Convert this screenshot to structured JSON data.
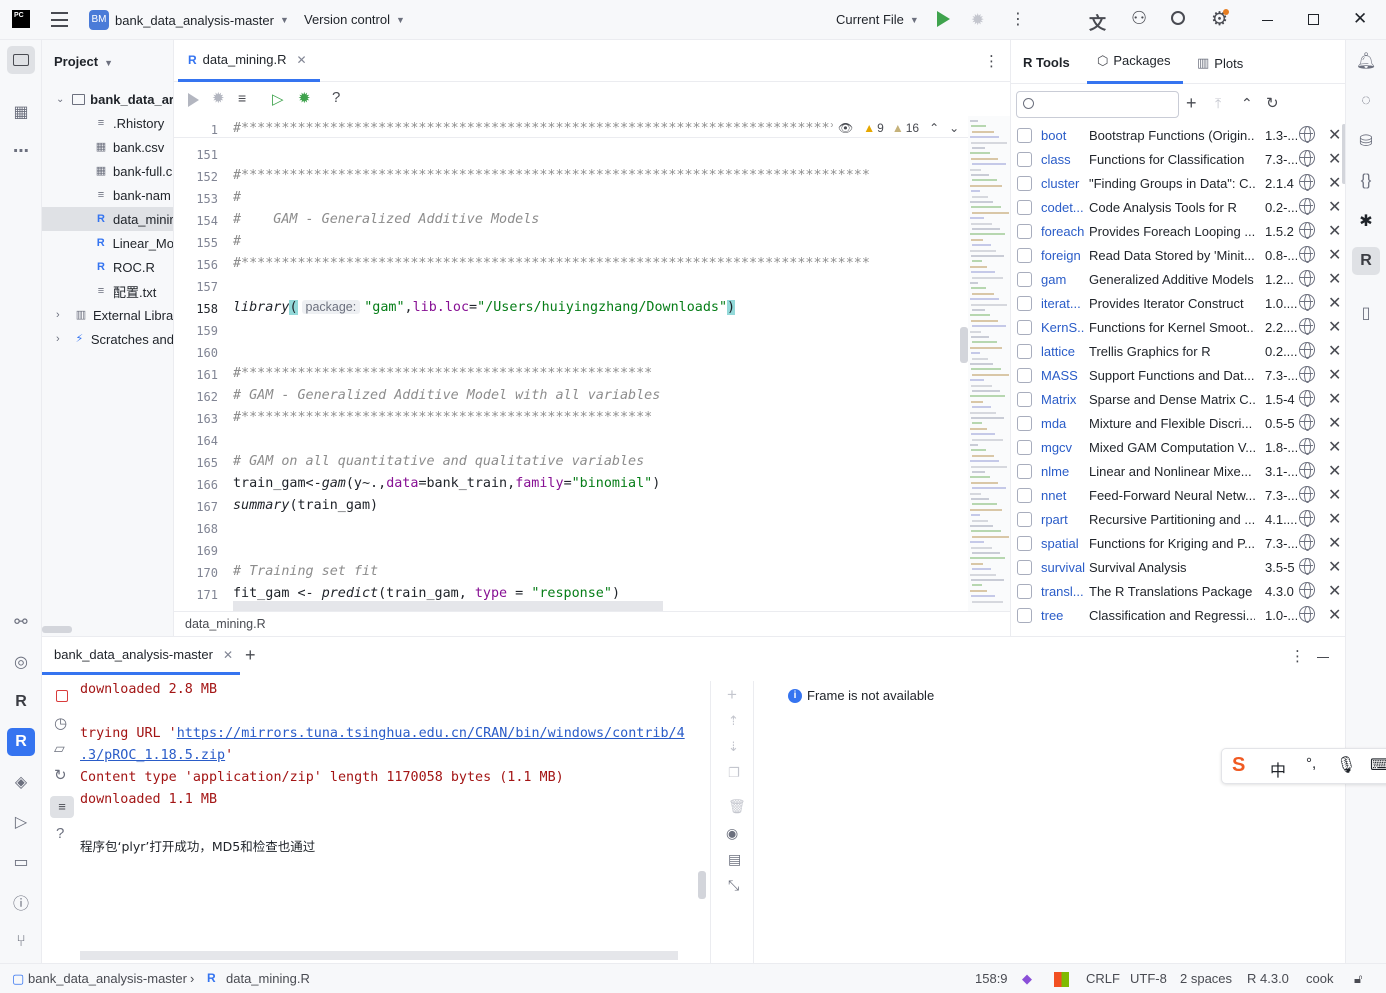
{
  "titlebar": {
    "app_logo": "PC",
    "project_badge": "BM",
    "project_name": "bank_data_analysis-master",
    "vcs": "Version control",
    "run_config": "Current File"
  },
  "project_panel": {
    "title": "Project",
    "root": "bank_data_ar",
    "files": [
      {
        "name": ".Rhistory",
        "icon": "text-file-icon"
      },
      {
        "name": "bank.csv",
        "icon": "csv-file-icon"
      },
      {
        "name": "bank-full.c",
        "icon": "csv-file-icon"
      },
      {
        "name": "bank-nam",
        "icon": "text-file-icon"
      },
      {
        "name": "data_minir",
        "icon": "r-file-icon"
      },
      {
        "name": "Linear_Mo",
        "icon": "r-file-icon"
      },
      {
        "name": "ROC.R",
        "icon": "r-file-icon"
      },
      {
        "name": "配置.txt",
        "icon": "text-file-icon"
      }
    ],
    "external": "External Libra",
    "scratches": "Scratches and"
  },
  "editor": {
    "tab": "data_mining.R",
    "breadcrumb": "data_mining.R",
    "warnings": "9",
    "weak_warnings": "16",
    "lines": [
      {
        "n": "1",
        "t": "#*******************************************************************************"
      },
      {
        "n": "151",
        "t": ""
      },
      {
        "n": "152",
        "t": "#******************************************************************************"
      },
      {
        "n": "153",
        "t": "#"
      },
      {
        "n": "154",
        "t": "#    GAM - Generalized Additive Models"
      },
      {
        "n": "155",
        "t": "#"
      },
      {
        "n": "156",
        "t": "#******************************************************************************"
      },
      {
        "n": "157",
        "t": ""
      },
      {
        "n": "158",
        "t": "library( package: \"gam\",lib.loc=\"/Users/huiyingzhang/Downloads\")"
      },
      {
        "n": "159",
        "t": ""
      },
      {
        "n": "160",
        "t": ""
      },
      {
        "n": "161",
        "t": "#***************************************************"
      },
      {
        "n": "162",
        "t": "# GAM - Generalized Additive Model with all variables"
      },
      {
        "n": "163",
        "t": "#***************************************************"
      },
      {
        "n": "164",
        "t": ""
      },
      {
        "n": "165",
        "t": "# GAM on all quantitative and qualitative variables"
      },
      {
        "n": "166",
        "t": "train_gam<-gam(y~.,data=bank_train,family=\"binomial\")"
      },
      {
        "n": "167",
        "t": "summary(train_gam)"
      },
      {
        "n": "168",
        "t": ""
      },
      {
        "n": "169",
        "t": ""
      },
      {
        "n": "170",
        "t": "# Training set fit"
      },
      {
        "n": "171",
        "t": "fit_gam <- predict(train_gam, type = \"response\")"
      }
    ],
    "line158": {
      "fn": "library",
      "hint": "package:",
      "arg1": "\"gam\"",
      "arg2key": "lib.loc",
      "arg2": "\"/Users/huiyingzhang/Downloads\""
    },
    "line166": {
      "a": "train_gam<-",
      "fn": "gam",
      "b": "(y~.,",
      "k1": "data",
      "c": "=bank_train,",
      "k2": "family",
      "d": "=",
      "s": "\"binomial\"",
      "e": ")"
    },
    "line167": {
      "fn": "summary",
      "rest": "(train_gam)"
    },
    "line171": {
      "a": "fit_gam <- ",
      "fn": "predict",
      "b": "(train_gam, ",
      "k": "type",
      "c": " = ",
      "s": "\"response\"",
      "e": ")"
    }
  },
  "rtools": {
    "tabs": [
      "R Tools",
      "Packages",
      "Plots"
    ],
    "search_placeholder": "",
    "packages": [
      {
        "name": "boot",
        "desc": "Bootstrap Functions (Origin...",
        "ver": "1.3-..."
      },
      {
        "name": "class",
        "desc": "Functions for Classification",
        "ver": "7.3-..."
      },
      {
        "name": "cluster",
        "desc": "\"Finding Groups in Data\": C...",
        "ver": "2.1.4"
      },
      {
        "name": "codet...",
        "desc": "Code Analysis Tools for R",
        "ver": "0.2-..."
      },
      {
        "name": "foreach",
        "desc": "Provides Foreach Looping ...",
        "ver": "1.5.2"
      },
      {
        "name": "foreign",
        "desc": "Read Data Stored by 'Minit...",
        "ver": "0.8-..."
      },
      {
        "name": "gam",
        "desc": "Generalized Additive Models",
        "ver": "1.2..."
      },
      {
        "name": "iterat...",
        "desc": "Provides Iterator Construct",
        "ver": "1.0...."
      },
      {
        "name": "KernS...",
        "desc": "Functions for Kernel Smoot...",
        "ver": "2.2...."
      },
      {
        "name": "lattice",
        "desc": "Trellis Graphics for R",
        "ver": "0.2...."
      },
      {
        "name": "MASS",
        "desc": "Support Functions and Dat...",
        "ver": "7.3-..."
      },
      {
        "name": "Matrix",
        "desc": "Sparse and Dense Matrix C...",
        "ver": "1.5-4"
      },
      {
        "name": "mda",
        "desc": "Mixture and Flexible Discri...",
        "ver": "0.5-5"
      },
      {
        "name": "mgcv",
        "desc": "Mixed GAM Computation V...",
        "ver": "1.8-..."
      },
      {
        "name": "nlme",
        "desc": "Linear and Nonlinear Mixe...",
        "ver": "3.1-..."
      },
      {
        "name": "nnet",
        "desc": "Feed-Forward Neural Netw...",
        "ver": "7.3-..."
      },
      {
        "name": "rpart",
        "desc": "Recursive Partitioning and ...",
        "ver": "4.1...."
      },
      {
        "name": "spatial",
        "desc": "Functions for Kriging and P...",
        "ver": "7.3-..."
      },
      {
        "name": "survival",
        "desc": "Survival Analysis",
        "ver": "3.5-5"
      },
      {
        "name": "transl...",
        "desc": "The R Translations Package",
        "ver": "4.3.0"
      },
      {
        "name": "tree",
        "desc": "Classification and Regressi...",
        "ver": "1.0-..."
      }
    ]
  },
  "console": {
    "tab": "bank_data_analysis-master",
    "lines": [
      {
        "t": "downloaded 2.8 MB",
        "cls": "red"
      },
      {
        "t": "",
        "cls": "red"
      },
      {
        "t": "trying URL 'https://mirrors.tuna.tsinghua.edu.cn/CRAN/bin/windows/contrib/4",
        "cls": "red"
      },
      {
        "t": ".3/pROC_1.18.5.zip'",
        "cls": "red"
      },
      {
        "t": "Content type 'application/zip' length 1170058 bytes (1.1 MB)",
        "cls": "red"
      },
      {
        "t": "downloaded 1.1 MB",
        "cls": "red"
      },
      {
        "t": "",
        "cls": "red"
      },
      {
        "t": "程序包‘plyr’打开成功，MD5和检查也通过",
        "cls": "black"
      }
    ],
    "url_prefix": "trying URL '",
    "url1": "https://mirrors.tuna.tsinghua.edu.cn/CRAN/bin/windows/contrib/4",
    "url2": ".3/pROC_1.18.5.zip",
    "frame_msg": "Frame is not available"
  },
  "ime": {
    "zh": "中"
  },
  "status": {
    "path1": "bank_data_analysis-master",
    "path2": "data_mining.R",
    "position": "158:9",
    "line_sep": "CRLF",
    "encoding": "UTF-8",
    "indent": "2 spaces",
    "r_version": "R 4.3.0",
    "user": "cook"
  }
}
